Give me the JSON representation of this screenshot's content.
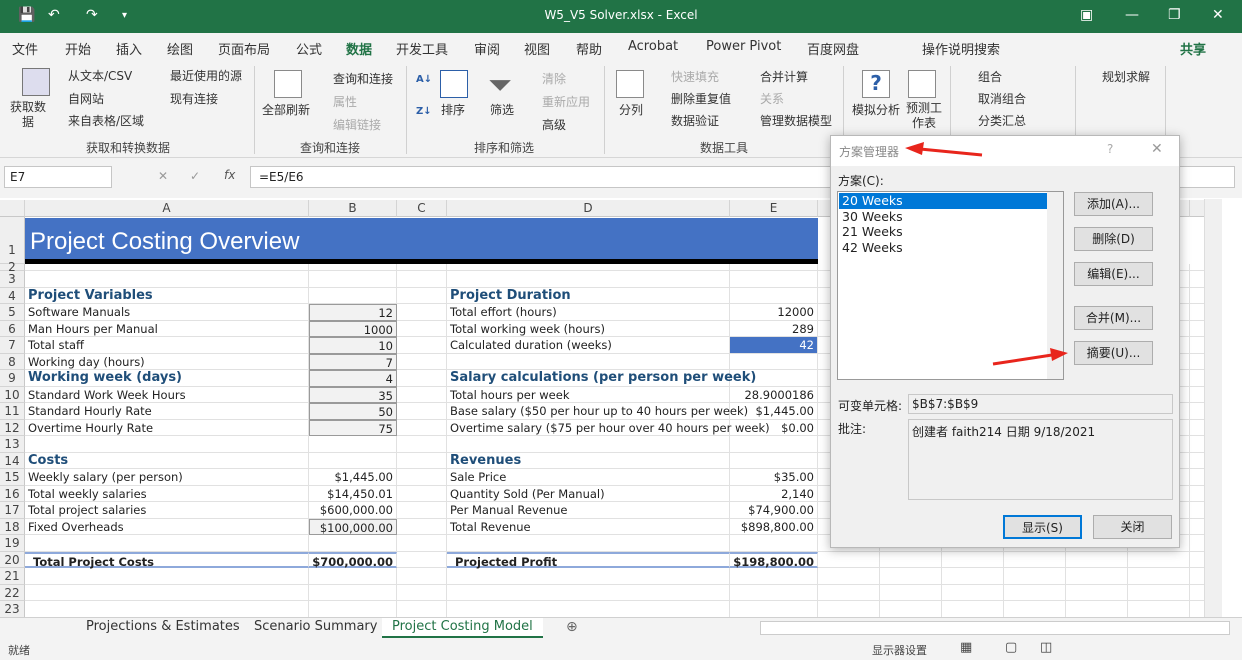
{
  "window": {
    "title": "W5_V5 Solver.xlsx  -  Excel",
    "icons": [
      "save-icon",
      "undo-icon",
      "redo-icon",
      "customize-icon"
    ]
  },
  "menu": {
    "items": [
      "文件",
      "开始",
      "插入",
      "绘图",
      "页面布局",
      "公式",
      "数据",
      "开发工具",
      "审阅",
      "视图",
      "帮助",
      "Acrobat",
      "Power Pivot",
      "百度网盘",
      "操作说明搜索"
    ],
    "active": 6,
    "share": "共享"
  },
  "ribbon": {
    "get": {
      "big": "获取数据",
      "items": [
        "从文本/CSV",
        "自网站",
        "来自表格/区域",
        "最近使用的源",
        "现有连接"
      ],
      "group": "获取和转换数据"
    },
    "query": {
      "big": "全部刷新",
      "items": [
        "查询和连接",
        "属性",
        "编辑链接"
      ],
      "group": "查询和连接"
    },
    "sort": {
      "sort": "排序",
      "filter": "筛选",
      "items": [
        "清除",
        "重新应用",
        "高级"
      ],
      "group": "排序和筛选"
    },
    "tools": {
      "big": "分列",
      "items": [
        "快速填充",
        "删除重复值",
        "数据验证",
        "合并计算",
        "关系",
        "管理数据模型"
      ],
      "group": "数据工具"
    },
    "forecast": {
      "whatif": "模拟分析",
      "sheet": "预测工作表"
    },
    "outline": {
      "items": [
        "组合",
        "取消组合",
        "分类汇总"
      ]
    },
    "solver": "规划求解"
  },
  "formula": {
    "cell": "E7",
    "value": "=E5/E6",
    "fx": "fx"
  },
  "columns": [
    "A",
    "B",
    "C",
    "D",
    "E"
  ],
  "title": "Project Costing Overview",
  "rows": [
    {
      "n": "1"
    },
    {
      "n": "2"
    },
    {
      "n": "3"
    },
    {
      "n": "4",
      "A": "Project Variables",
      "D": "Project Duration"
    },
    {
      "n": "5",
      "A": "Software Manuals",
      "B": "12",
      "D": "Total effort (hours)",
      "E": "12000"
    },
    {
      "n": "6",
      "A": "Man Hours per Manual",
      "B": "1000",
      "D": "Total working week (hours)",
      "E": "289"
    },
    {
      "n": "7",
      "A": "Total staff",
      "B": "10",
      "D": "Calculated duration (weeks)",
      "E": "42"
    },
    {
      "n": "8",
      "A": "Working day (hours)",
      "B": "7"
    },
    {
      "n": "9",
      "A": "Working week (days)",
      "B": "4",
      "D": "Salary calculations (per person per week)"
    },
    {
      "n": "10",
      "A": "Standard Work Week Hours",
      "B": "35",
      "D": "Total hours per week",
      "E": "28.9000186"
    },
    {
      "n": "11",
      "A": "Standard Hourly Rate",
      "B": "50",
      "D": "Base salary ($50 per hour up to 40 hours per week)",
      "E": "$1,445.00"
    },
    {
      "n": "12",
      "A": "Overtime Hourly Rate",
      "B": "75",
      "D": "Overtime salary ($75 per hour over 40 hours per week)",
      "E": "$0.00"
    },
    {
      "n": "13"
    },
    {
      "n": "14",
      "A": "Costs",
      "D": "Revenues"
    },
    {
      "n": "15",
      "A": "Weekly salary (per person)",
      "B": "$1,445.00",
      "D": "Sale Price",
      "E": "$35.00"
    },
    {
      "n": "16",
      "A": "Total weekly salaries",
      "B": "$14,450.01",
      "D": "Quantity Sold (Per Manual)",
      "E": "2,140"
    },
    {
      "n": "17",
      "A": "Total project salaries",
      "B": "$600,000.00",
      "D": "Per Manual Revenue",
      "E": "$74,900.00"
    },
    {
      "n": "18",
      "A": "Fixed Overheads",
      "B": "$100,000.00",
      "D": "Total Revenue",
      "E": "$898,800.00"
    },
    {
      "n": "19"
    },
    {
      "n": "20",
      "A": "Total Project Costs",
      "B": "$700,000.00",
      "D": "Projected Profit",
      "E": "$198,800.00"
    },
    {
      "n": "21"
    },
    {
      "n": "22"
    },
    {
      "n": "23"
    }
  ],
  "sheets": [
    "Projections & Estimates",
    "Scenario Summary",
    "Project Costing Model"
  ],
  "active_sheet": 2,
  "status": {
    "ready": "就绪",
    "display": "显示器设置"
  },
  "dialog": {
    "title": "方案管理器",
    "list_label": "方案(C):",
    "scenarios": [
      "20 Weeks",
      "30 Weeks",
      "21 Weeks",
      "42 Weeks"
    ],
    "selected": 0,
    "buttons": {
      "add": "添加(A)...",
      "delete": "删除(D)",
      "edit": "编辑(E)...",
      "merge": "合并(M)...",
      "summary": "摘要(U)...",
      "show": "显示(S)",
      "close": "关闭"
    },
    "changing_label": "可变单元格:",
    "changing_value": "$B$7:$B$9",
    "comment_label": "批注:",
    "comment_value": "创建者 faith214 日期 9/18/2021"
  },
  "colors": {
    "excel_green": "#217346",
    "title_blue": "#4472c4",
    "arrow": "#e8251c"
  }
}
